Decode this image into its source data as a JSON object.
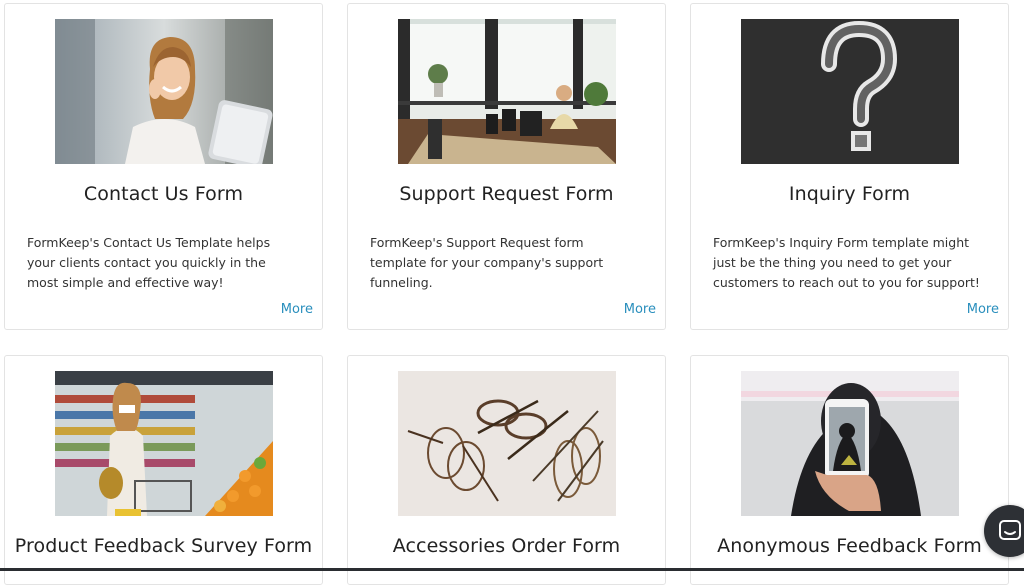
{
  "cards": [
    {
      "title": "Contact Us Form",
      "description": "FormKeep's Contact Us Template helps your clients contact you quickly in the most simple and effective way!",
      "more": "More"
    },
    {
      "title": "Support Request Form",
      "description": "FormKeep's Support Request form template for your company's support funneling.",
      "more": "More"
    },
    {
      "title": "Inquiry Form",
      "description": "FormKeep's Inquiry Form template might just be the thing you need to get your customers to reach out to you for support!",
      "more": "More"
    },
    {
      "title": "Product Feedback Survey Form"
    },
    {
      "title": "Accessories Order Form"
    },
    {
      "title": "Anonymous Feedback Form"
    }
  ],
  "chat_widget": {
    "icon": "chat-icon"
  },
  "colors": {
    "link": "#2a8fbd",
    "border": "#e3e3e3",
    "chat_bg": "#2d3035"
  }
}
